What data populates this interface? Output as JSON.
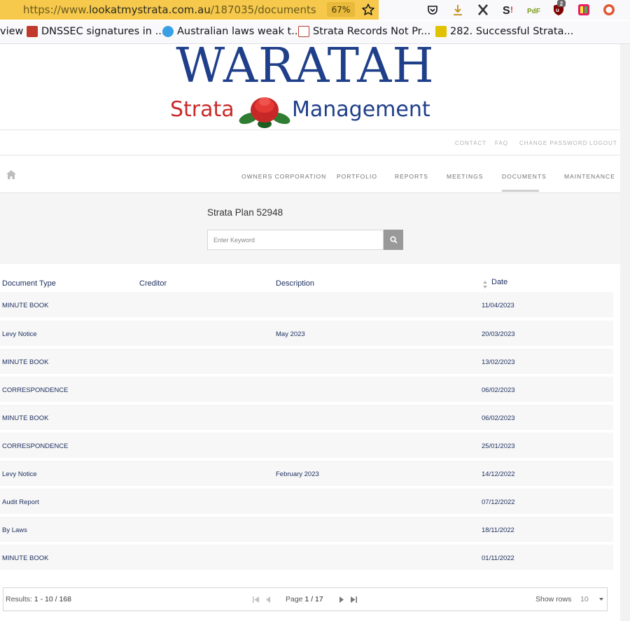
{
  "browser": {
    "url_prefix": "https://www.",
    "url_host": "lookatmystrata.com.au",
    "url_path": "/187035/documents",
    "zoom": "67%",
    "bookmarks": [
      {
        "label": "view"
      },
      {
        "label": "DNSSEC signatures in ..."
      },
      {
        "label": "Australian laws weak t..."
      },
      {
        "label": "Strata Records Not Pr..."
      },
      {
        "label": "282. Successful Strata..."
      }
    ],
    "extension_badge": "2"
  },
  "logo": {
    "title": "WARATAH",
    "sub_left": "Strata",
    "sub_right": "Management"
  },
  "topnav": {
    "contact": "CONTACT",
    "faq": "FAQ",
    "change_password": "CHANGE PASSWORD",
    "logout": "LOGOUT"
  },
  "mainnav": {
    "owners_corporation": "OWNERS CORPORATION",
    "portfolio": "PORTFOLIO",
    "reports": "REPORTS",
    "meetings": "MEETINGS",
    "documents": "DOCUMENTS",
    "maintenance": "MAINTENANCE"
  },
  "search": {
    "plan_title": "Strata Plan 52948",
    "placeholder": "Enter Keyword"
  },
  "table": {
    "headers": {
      "document_type": "Document Type",
      "creditor": "Creditor",
      "description": "Description",
      "date": "Date"
    },
    "rows": [
      {
        "type": "MINUTE BOOK",
        "creditor": "",
        "description": "",
        "date": "11/04/2023"
      },
      {
        "type": "Levy Notice",
        "creditor": "",
        "description": "May 2023",
        "date": "20/03/2023"
      },
      {
        "type": "MINUTE BOOK",
        "creditor": "",
        "description": "",
        "date": "13/02/2023"
      },
      {
        "type": "CORRESPONDENCE",
        "creditor": "",
        "description": "",
        "date": "06/02/2023"
      },
      {
        "type": "MINUTE BOOK",
        "creditor": "",
        "description": "",
        "date": "06/02/2023"
      },
      {
        "type": "CORRESPONDENCE",
        "creditor": "",
        "description": "",
        "date": "25/01/2023"
      },
      {
        "type": "Levy Notice",
        "creditor": "",
        "description": "February 2023",
        "date": "14/12/2022"
      },
      {
        "type": "Audit Report",
        "creditor": "",
        "description": "",
        "date": "07/12/2022"
      },
      {
        "type": "By Laws",
        "creditor": "",
        "description": "",
        "date": "18/11/2022"
      },
      {
        "type": "MINUTE BOOK",
        "creditor": "",
        "description": "",
        "date": "01/11/2022"
      }
    ]
  },
  "pager": {
    "results_label": "Results: ",
    "results_value": "1 - 10 / 168",
    "page_label": "Page ",
    "page_value": "1 / 17",
    "show_rows_label": "Show rows",
    "rows_value": "10"
  },
  "colors": {
    "url_bar": "#f6c94c",
    "brand_blue": "#1f3f8a",
    "brand_red": "#c92b2b",
    "link_navy": "#1e3060"
  }
}
